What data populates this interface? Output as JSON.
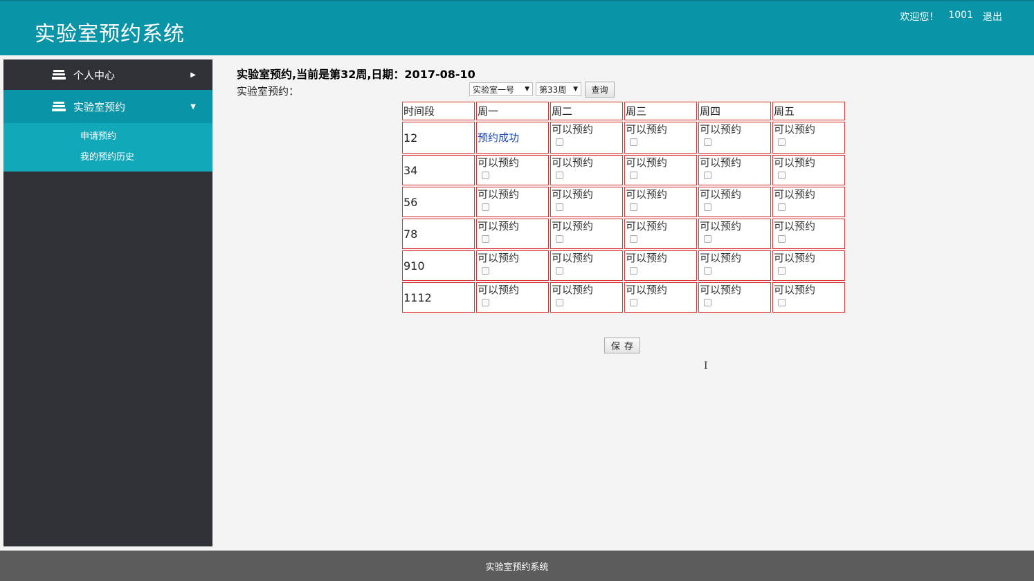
{
  "header": {
    "title": "实验室预约系统",
    "welcome": "欢迎您！",
    "user_id": "1001",
    "logout": "退出"
  },
  "sidebar": {
    "items": [
      {
        "label": "个人中心",
        "icon": "stack-icon",
        "caret": "▶"
      },
      {
        "label": "实验室预约",
        "icon": "stack-icon",
        "caret": "▼"
      }
    ],
    "submenu": [
      {
        "label": "申请预约"
      },
      {
        "label": "我的预约历史"
      }
    ]
  },
  "main": {
    "headline": "实验室预约,当前是第32周,日期：2017-08-10",
    "sublabel": "实验室预约：",
    "lab_select": "实验室一号",
    "week_select": "第33周",
    "query_button": "查询",
    "save_button": "保存",
    "table": {
      "headers": [
        "时间段",
        "周一",
        "周二",
        "周三",
        "周四",
        "周五"
      ],
      "available_text": "可以预约",
      "booked_text": "预约成功",
      "rows": [
        {
          "time": "12",
          "cells": [
            "booked",
            "available",
            "available",
            "available",
            "available"
          ]
        },
        {
          "time": "34",
          "cells": [
            "available",
            "available",
            "available",
            "available",
            "available"
          ]
        },
        {
          "time": "56",
          "cells": [
            "available",
            "available",
            "available",
            "available",
            "available"
          ]
        },
        {
          "time": "78",
          "cells": [
            "available",
            "available",
            "available",
            "available",
            "available"
          ]
        },
        {
          "time": "910",
          "cells": [
            "available",
            "available",
            "available",
            "available",
            "available"
          ]
        },
        {
          "time": "1112",
          "cells": [
            "available",
            "available",
            "available",
            "available",
            "available"
          ]
        }
      ]
    }
  },
  "footer": {
    "text": "实验室预约系统"
  },
  "colors": {
    "header_bg": "#0a94a7",
    "sidebar_bg": "#2f3136",
    "table_border": "#dd3333",
    "footer_bg": "#5c5c5c"
  }
}
